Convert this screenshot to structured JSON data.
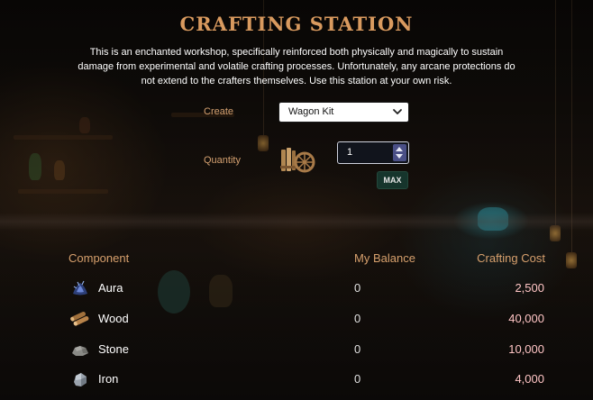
{
  "title": "CRAFTING STATION",
  "description": "This is an enchanted workshop, specifically reinforced both physically and magically to sustain damage from experimental and volatile crafting processes. Unfortunately, any arcane protections do not extend to the crafters themselves. Use this station at your own risk.",
  "form": {
    "create_label": "Create",
    "create_selected": "Wagon Kit",
    "quantity_label": "Quantity",
    "quantity_value": "1",
    "max_label": "MAX",
    "item_icon": "wagon-kit-icon"
  },
  "table": {
    "headers": {
      "component": "Component",
      "balance": "My Balance",
      "cost": "Crafting Cost"
    },
    "rows": [
      {
        "icon": "aura-icon",
        "name": "Aura",
        "balance": "0",
        "cost": "2,500"
      },
      {
        "icon": "wood-icon",
        "name": "Wood",
        "balance": "0",
        "cost": "40,000"
      },
      {
        "icon": "stone-icon",
        "name": "Stone",
        "balance": "0",
        "cost": "10,000"
      },
      {
        "icon": "iron-icon",
        "name": "Iron",
        "balance": "0",
        "cost": "4,000"
      }
    ]
  },
  "colors": {
    "title": "#d99a5f",
    "label": "#d5a170",
    "cost": "#ffc5c5",
    "max_button": "#16352c"
  }
}
